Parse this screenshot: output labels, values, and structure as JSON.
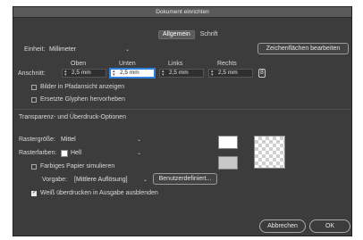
{
  "window": {
    "title": "Dokument einrichten"
  },
  "tabs": [
    {
      "label": "Allgemein",
      "active": true
    },
    {
      "label": "Schrift",
      "active": false
    }
  ],
  "unit": {
    "label": "Einheit:",
    "value": "Millimeter"
  },
  "artboard_button": "Zeichenflächen bearbeiten",
  "bleed": {
    "label": "Anschnitt:",
    "headers": {
      "top": "Oben",
      "bottom": "Unten",
      "left": "Links",
      "right": "Rechts"
    },
    "values": {
      "top": "2,5 mm",
      "bottom": "2,5 mm",
      "left": "2,5 mm",
      "right": "2,5 mm"
    },
    "link_icon": "chain-link-icon"
  },
  "options": {
    "show_images_outline": {
      "label": "Bilder in Pfadansicht anzeigen",
      "checked": false
    },
    "highlight_substituted_glyphs": {
      "label": "Ersetzte Glyphen hervorheben",
      "checked": false
    }
  },
  "transparency": {
    "section_title": "Transparenz- und Überdruck-Optionen",
    "grid_size": {
      "label": "Rastergröße:",
      "value": "Mittel"
    },
    "grid_colors": {
      "label": "Rasterfarben:",
      "value": "Hell",
      "chip_color": "#ffffff"
    },
    "simulate_paper": {
      "label": "Farbiges Papier simulieren",
      "checked": false
    },
    "preset": {
      "label": "Vorgabe:",
      "value": "[Mittlere Auflösung]"
    },
    "custom_button": "Benutzerdefiniert...",
    "discard_white_overprint": {
      "label": "Weiß überdrucken in Ausgabe ausblenden",
      "checked": true
    }
  },
  "buttons": {
    "cancel": "Abbrechen",
    "ok": "OK"
  },
  "colors": {
    "dialog_bg": "#3c3c3c",
    "focus": "#2e7fe0"
  }
}
